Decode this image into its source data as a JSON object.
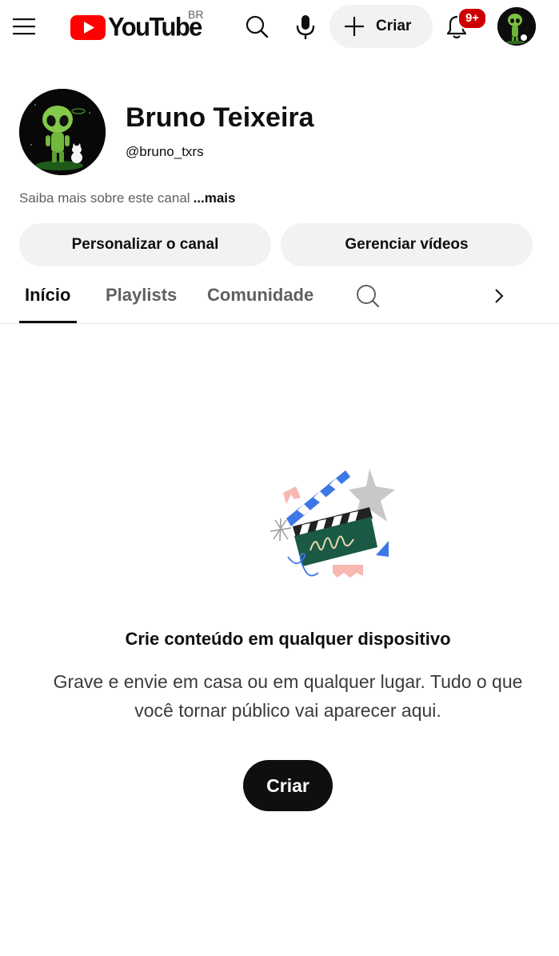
{
  "header": {
    "logo_text": "YouTube",
    "region": "BR",
    "create_label": "Criar",
    "notification_count": "9+"
  },
  "channel": {
    "name": "Bruno Teixeira",
    "handle": "@bruno_txrs",
    "about": "Saiba mais sobre este canal",
    "about_more": "...mais",
    "customize_button": "Personalizar o canal",
    "manage_button": "Gerenciar vídeos"
  },
  "tabs": [
    {
      "label": "Início",
      "active": true
    },
    {
      "label": "Playlists",
      "active": false
    },
    {
      "label": "Comunidade",
      "active": false
    }
  ],
  "empty_state": {
    "title": "Crie conteúdo em qualquer dispositivo",
    "description": "Grave e envie em casa ou em qualquer lugar. Tudo o que você tornar público vai aparecer aqui.",
    "button": "Criar"
  },
  "colors": {
    "brand_red": "#ff0000",
    "badge_red": "#cc0000",
    "pill_bg": "#f2f2f2",
    "dark_button": "#0f0f0f"
  },
  "icons": [
    "menu-icon",
    "youtube-play-icon",
    "search-icon",
    "mic-icon",
    "plus-icon",
    "bell-icon",
    "chevron-right-icon"
  ]
}
